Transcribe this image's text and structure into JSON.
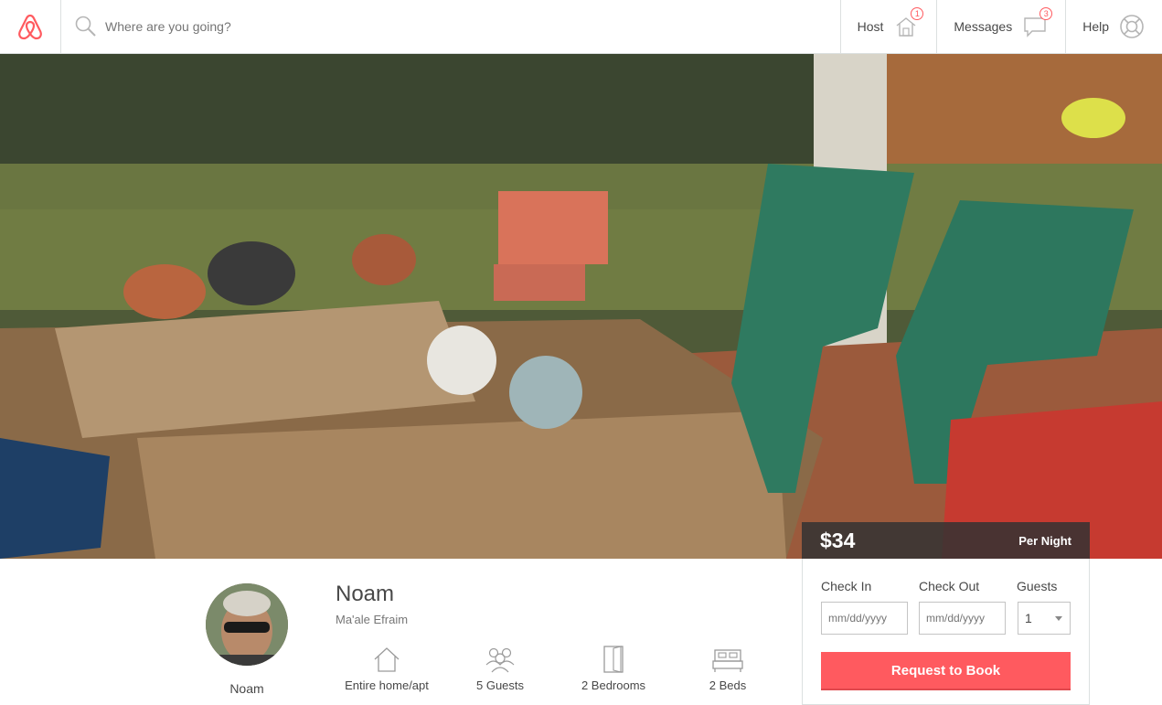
{
  "header": {
    "search_placeholder": "Where are you going?",
    "host_label": "Host",
    "host_badge": "1",
    "messages_label": "Messages",
    "messages_badge": "3",
    "help_label": "Help"
  },
  "listing": {
    "host_name": "Noam",
    "title": "Noam",
    "location": "Ma'ale Efraim",
    "amenities": [
      {
        "icon": "home-icon",
        "label": "Entire home/apt"
      },
      {
        "icon": "guests-icon",
        "label": "5 Guests"
      },
      {
        "icon": "door-icon",
        "label": "2 Bedrooms"
      },
      {
        "icon": "bed-icon",
        "label": "2 Beds"
      }
    ]
  },
  "booking": {
    "price": "$34",
    "per": "Per Night",
    "checkin_label": "Check In",
    "checkout_label": "Check Out",
    "guests_label": "Guests",
    "date_placeholder": "mm/dd/yyyy",
    "guests_value": "1",
    "button_label": "Request to Book"
  },
  "colors": {
    "brand": "#ff5a5f",
    "text": "#484848"
  }
}
